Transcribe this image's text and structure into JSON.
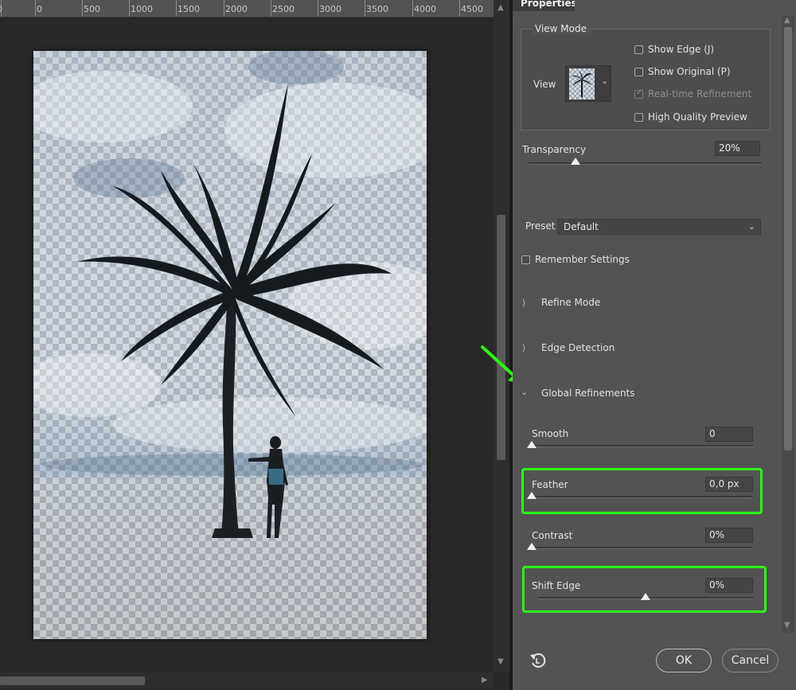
{
  "ruler": {
    "labels": [
      "0",
      "500",
      "1000",
      "1500",
      "2000",
      "2500",
      "3000",
      "3500",
      "4000",
      "4500"
    ]
  },
  "panel": {
    "tab_title": "Properties",
    "view_mode": {
      "legend": "View Mode",
      "view_label": "View",
      "show_edge": "Show Edge (J)",
      "show_original": "Show Original (P)",
      "realtime_refinement": "Real-time Refinement",
      "high_quality_preview": "High Quality Preview"
    },
    "transparency": {
      "label": "Transparency",
      "value": "20%",
      "level": 0.2
    },
    "preset": {
      "label": "Preset",
      "value": "Default"
    },
    "remember_settings": "Remember Settings",
    "sections": {
      "refine_mode": "Refine Mode",
      "edge_detection": "Edge Detection",
      "global_refinements": "Global Refinements"
    },
    "smooth": {
      "label": "Smooth",
      "value": "0",
      "level": 0.0
    },
    "feather": {
      "label": "Feather",
      "value": "0,0 px",
      "level": 0.0
    },
    "contrast": {
      "label": "Contrast",
      "value": "0%",
      "level": 0.0
    },
    "shift_edge": {
      "label": "Shift Edge",
      "value": "0%",
      "level": 0.5
    },
    "buttons": {
      "ok": "OK",
      "cancel": "Cancel"
    }
  },
  "colors": {
    "highlight": "#2dfc14",
    "panel_bg": "#535353",
    "canvas_bg": "#282828"
  },
  "icons": [
    "reset-icon",
    "chevron-down-icon",
    "chevron-right-icon",
    "annotation-arrow-icon"
  ]
}
